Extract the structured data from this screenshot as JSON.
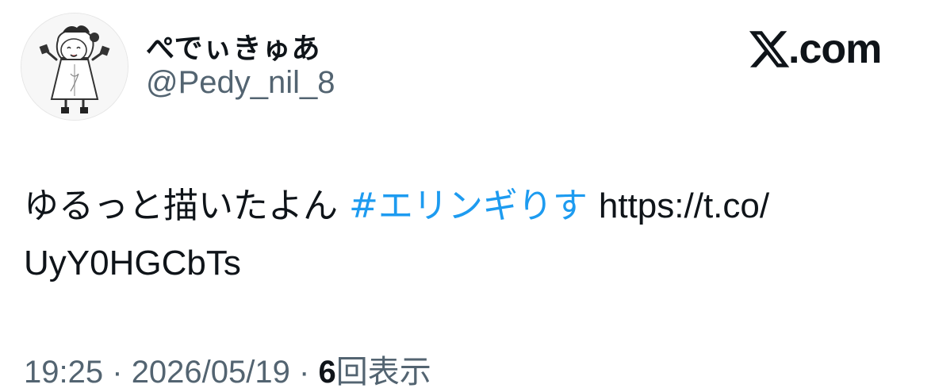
{
  "user": {
    "display_name": "ぺでぃきゅあ",
    "handle": "@Pedy_nil_8"
  },
  "brand": {
    "domain": ".com",
    "icon": "x-logo-icon"
  },
  "tweet": {
    "text": "ゆるっと描いたよん",
    "hashtag": "#エリンギりす",
    "url_part1": "https://t.co/",
    "url_part2": "UyY0HGCbTs"
  },
  "meta": {
    "time": "19:25",
    "date": "2026/05/19",
    "separator": "·",
    "views_count": "6",
    "views_label": "回表示"
  },
  "colors": {
    "hashtag": "#1d9bf0",
    "secondary_text": "#536471",
    "primary_text": "#0f1419"
  }
}
